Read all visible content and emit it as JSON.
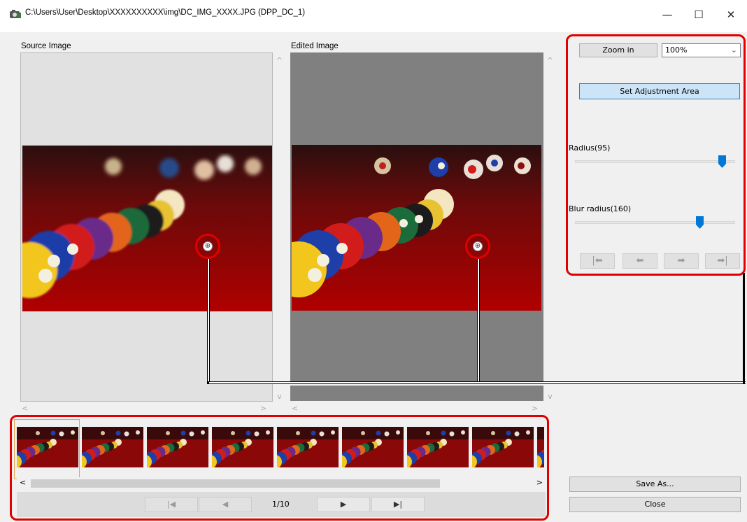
{
  "window": {
    "title": "C:\\Users\\User\\Desktop\\XXXXXXXXXX\\img\\DC_IMG_XXXX.JPG (DPP_DC_1)",
    "minimize_glyph": "—",
    "maximize_glyph": "☐",
    "close_glyph": "✕"
  },
  "source": {
    "label": "Source Image"
  },
  "edited": {
    "label": "Edited Image"
  },
  "controls": {
    "zoom_button": "Zoom in",
    "zoom_value": "100%",
    "set_area_button": "Set Adjustment Area",
    "radius_label": "Radius(95)",
    "radius_value": 95,
    "radius_fraction": 0.94,
    "blur_label": "Blur radius(160)",
    "blur_value": 160,
    "blur_fraction": 0.78,
    "nav_first": "|⬅",
    "nav_undo": "⬅",
    "nav_redo": "➡",
    "nav_last": "➡|"
  },
  "filmstrip": {
    "page": "1/10",
    "thumb_count": 9,
    "scroll_left": "<",
    "scroll_right": ">",
    "first_glyph": "|◀",
    "prev_glyph": "◀",
    "next_glyph": "▶",
    "last_glyph": "▶|"
  },
  "actions": {
    "save_as": "Save As...",
    "close": "Close"
  },
  "colors": {
    "highlight": "#e00000",
    "accent_blue": "#0078d7"
  }
}
